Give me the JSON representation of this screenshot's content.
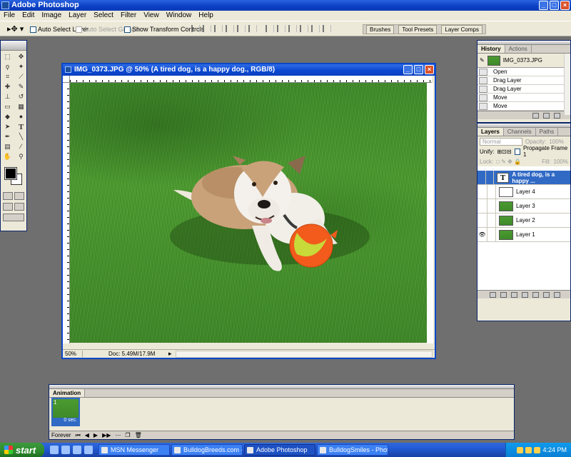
{
  "app": {
    "title": "Adobe Photoshop"
  },
  "menu": [
    "File",
    "Edit",
    "Image",
    "Layer",
    "Select",
    "Filter",
    "View",
    "Window",
    "Help"
  ],
  "options": {
    "auto_select_layer": "Auto Select Layer",
    "auto_select_groups": "Auto Select Groups",
    "show_transform": "Show Transform Controls",
    "well_tabs": [
      "Brushes",
      "Tool Presets",
      "Layer Comps"
    ]
  },
  "document": {
    "title": "IMG_0373.JPG @ 50% (A tired dog, is a happy dog., RGB/8)",
    "zoom": "50%",
    "doc_size": "Doc: 5.49M/17.9M"
  },
  "history": {
    "tabs": [
      "History",
      "Actions"
    ],
    "snapshot": "IMG_0373.JPG",
    "items": [
      "Open",
      "Drag Layer",
      "Drag Layer",
      "Move",
      "Move"
    ]
  },
  "layers": {
    "tabs": [
      "Layers",
      "Channels",
      "Paths"
    ],
    "blend_mode": "Normal",
    "opacity_label": "Opacity:",
    "opacity": "100%",
    "unify_label": "Unify:",
    "propagate": "Propagate Frame 1",
    "lock_label": "Lock:",
    "fill_label": "Fill:",
    "fill": "100%",
    "items": [
      {
        "name": "A tired dog, is a happy ...",
        "type": "text",
        "selected": true
      },
      {
        "name": "Layer 4",
        "type": "white"
      },
      {
        "name": "Layer 3",
        "type": "image"
      },
      {
        "name": "Layer 2",
        "type": "image"
      },
      {
        "name": "Layer 1",
        "type": "image",
        "visible": true
      }
    ]
  },
  "animation": {
    "title": "Animation",
    "frame_number": "1",
    "frame_delay": "0 sec.",
    "loop": "Forever"
  },
  "taskbar": {
    "start": "start",
    "tasks": [
      "MSN Messenger",
      "BulldogBreeds.com - ...",
      "Adobe Photoshop",
      "BulldogSmiles - Photo..."
    ],
    "clock": "4:24 PM"
  },
  "colors": {
    "titlebar": "#0a48d2",
    "panel": "#ece9d8",
    "workspace": "#6f6f6f",
    "grass": "#3f8a2a"
  }
}
